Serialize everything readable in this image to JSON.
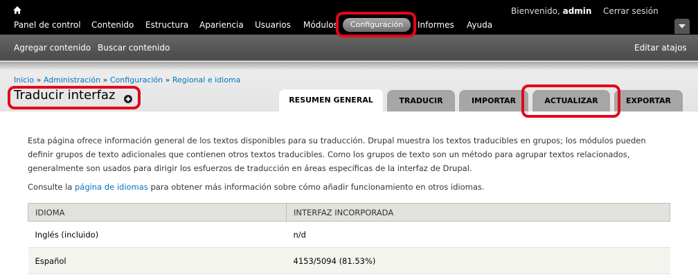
{
  "toolbar": {
    "home_icon": "home-icon",
    "welcome_prefix": "Bienvenido,",
    "username": "admin",
    "logout_label": "Cerrar sesión",
    "menu": [
      {
        "label": "Panel de control"
      },
      {
        "label": "Contenido"
      },
      {
        "label": "Estructura"
      },
      {
        "label": "Apariencia"
      },
      {
        "label": "Usuarios"
      },
      {
        "label": "Módulos"
      },
      {
        "label": "Configuración",
        "active": true
      },
      {
        "label": "Informes"
      },
      {
        "label": "Ayuda"
      }
    ],
    "toggle_icon": "chevron-down-icon"
  },
  "shortcuts": {
    "items": [
      "Agregar contenido",
      "Buscar contenido"
    ],
    "edit_label": "Editar atajos"
  },
  "breadcrumb": {
    "items": [
      "Inicio",
      "Administración",
      "Configuración",
      "Regional e idioma"
    ],
    "separator": "»"
  },
  "page": {
    "title": "Traducir interfaz",
    "add_shortcut_icon": "plus-circle-icon"
  },
  "tabs": [
    {
      "label": "RESUMEN GENERAL",
      "active": true
    },
    {
      "label": "TRADUCIR"
    },
    {
      "label": "IMPORTAR"
    },
    {
      "label": "ACTUALIZAR"
    },
    {
      "label": "EXPORTAR"
    }
  ],
  "content": {
    "intro": "Esta página ofrece información general de los textos disponibles para su traducción. Drupal muestra los textos traducibles en grupos; los módulos pueden definir grupos de texto adicionales que contienen otros textos traducibles. Como los grupos de texto son un método para agrupar textos relacionados, generalmente son usados para dirigir los esfuerzos de traducción en áreas específicas de la interfaz de Drupal.",
    "see_also_before": "Consulte la",
    "see_also_link": "página de idiomas",
    "see_also_after": "para obtener más información sobre cómo añadir funcionamiento en otros idiomas."
  },
  "table": {
    "headers": [
      "IDIOMA",
      "INTERFAZ INCORPORADA"
    ],
    "rows": [
      [
        "Inglés (incluido)",
        "n/d"
      ],
      [
        "Español",
        "4153/5094 (81.53%)"
      ]
    ]
  },
  "colors": {
    "toolbar_bg": "#000000",
    "link": "#0074bd",
    "annotation_red": "#e4061a",
    "tab_inactive": "#a6a6a6"
  }
}
